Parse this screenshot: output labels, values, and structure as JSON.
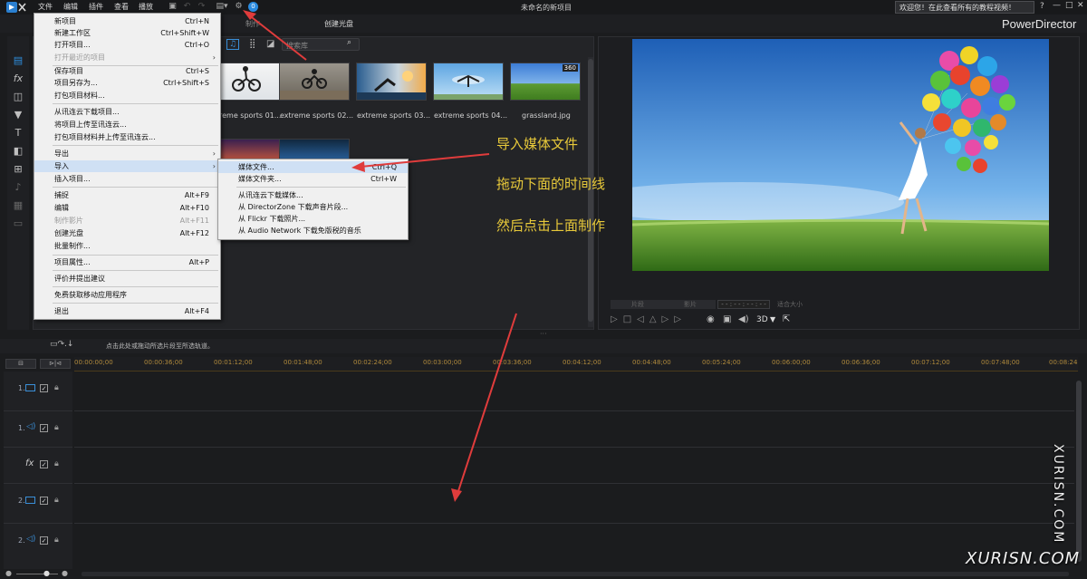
{
  "title_bar": {
    "menus": [
      "文件",
      "编辑",
      "插件",
      "查看",
      "播放"
    ],
    "project_title": "未命名的新项目",
    "notice": "欢迎您！在此查看所有的教程视频！",
    "help": "?",
    "brand": "PowerDirector"
  },
  "tabs": {
    "produce": "制作",
    "create_disc": "创建光盘"
  },
  "library": {
    "search_placeholder": "搜索库",
    "thumbnails": [
      {
        "label": "reme sports 01..."
      },
      {
        "label": "extreme sports 02..."
      },
      {
        "label": "extreme sports 03..."
      },
      {
        "label": "extreme sports 04..."
      },
      {
        "label": "grassland.jpg",
        "badge": "360"
      }
    ]
  },
  "file_menu": {
    "items": [
      {
        "label": "新项目",
        "shortcut": "Ctrl+N"
      },
      {
        "label": "新建工作区",
        "shortcut": "Ctrl+Shift+W"
      },
      {
        "label": "打开项目...",
        "shortcut": "Ctrl+O"
      },
      {
        "label": "打开最近的项目",
        "shortcut": "",
        "disabled": true,
        "submenu": true
      },
      {
        "label": "保存项目",
        "shortcut": "Ctrl+S"
      },
      {
        "label": "项目另存为...",
        "shortcut": "Ctrl+Shift+S"
      },
      {
        "label": "打包项目材料...",
        "shortcut": ""
      },
      {
        "label": "从讯连云下载项目...",
        "shortcut": ""
      },
      {
        "label": "将项目上传至讯连云...",
        "shortcut": ""
      },
      {
        "label": "打包项目材料并上传至讯连云...",
        "shortcut": ""
      },
      {
        "label": "导出",
        "shortcut": "",
        "submenu": true
      },
      {
        "label": "导入",
        "shortcut": "",
        "submenu": true,
        "highlighted": true
      },
      {
        "label": "插入项目...",
        "shortcut": ""
      },
      {
        "label": "捕捉",
        "shortcut": "Alt+F9"
      },
      {
        "label": "编辑",
        "shortcut": "Alt+F10"
      },
      {
        "label": "制作影片",
        "shortcut": "Alt+F11",
        "disabled": true
      },
      {
        "label": "创建光盘",
        "shortcut": "Alt+F12"
      },
      {
        "label": "批量制作...",
        "shortcut": ""
      },
      {
        "label": "项目属性...",
        "shortcut": "Alt+P"
      },
      {
        "label": "评价并提出建议",
        "shortcut": ""
      },
      {
        "label": "免费获取移动应用程序",
        "shortcut": ""
      },
      {
        "label": "退出",
        "shortcut": "Alt+F4"
      }
    ]
  },
  "import_submenu": {
    "items": [
      {
        "label": "媒体文件...",
        "shortcut": "Ctrl+Q",
        "highlighted": true
      },
      {
        "label": "媒体文件夹...",
        "shortcut": "Ctrl+W"
      },
      {
        "label": "从讯连云下载媒体...",
        "shortcut": ""
      },
      {
        "label": "从 DirectorZone 下载声音片段...",
        "shortcut": ""
      },
      {
        "label": "从 Flickr 下载照片...",
        "shortcut": ""
      },
      {
        "label": "从 Audio Network 下载免版税的音乐",
        "shortcut": ""
      }
    ]
  },
  "annotations": {
    "step1": "导入媒体文件",
    "step2": "拖动下面的时间线",
    "step3": "然后点击上面制作"
  },
  "preview": {
    "timecode": "- - : - - : - - : - -",
    "mode_3d": "3D",
    "btn_a": "片段",
    "btn_b": "影片",
    "zoom": "适合大小"
  },
  "timeline": {
    "hint": "点击此处或拖动所选片段至所选轨道。",
    "ticks": [
      "00:00:00;00",
      "00:00:36;00",
      "00:01:12;00",
      "00:01:48;00",
      "00:02:24;00",
      "00:03:00;00",
      "00:03:36;00",
      "00:04:12;00",
      "00:04:48;00",
      "00:05:24;00",
      "00:06:00;00",
      "00:06:36;00",
      "00:07:12;00",
      "00:07:48;00",
      "00:08:24"
    ],
    "tracks": [
      {
        "num": "1.",
        "type": "video"
      },
      {
        "num": "1.",
        "type": "audio"
      },
      {
        "num": "",
        "type": "fx"
      },
      {
        "num": "2.",
        "type": "video"
      },
      {
        "num": "2.",
        "type": "audio"
      }
    ]
  },
  "watermark": {
    "vertical": "XURISN.COM",
    "bottom": "XURISN.COM"
  },
  "colors": {
    "accent": "#3a8fd8",
    "annotation": "#e8c93a",
    "arrow": "#e03c3c",
    "highlight": "#cfe0f4"
  }
}
